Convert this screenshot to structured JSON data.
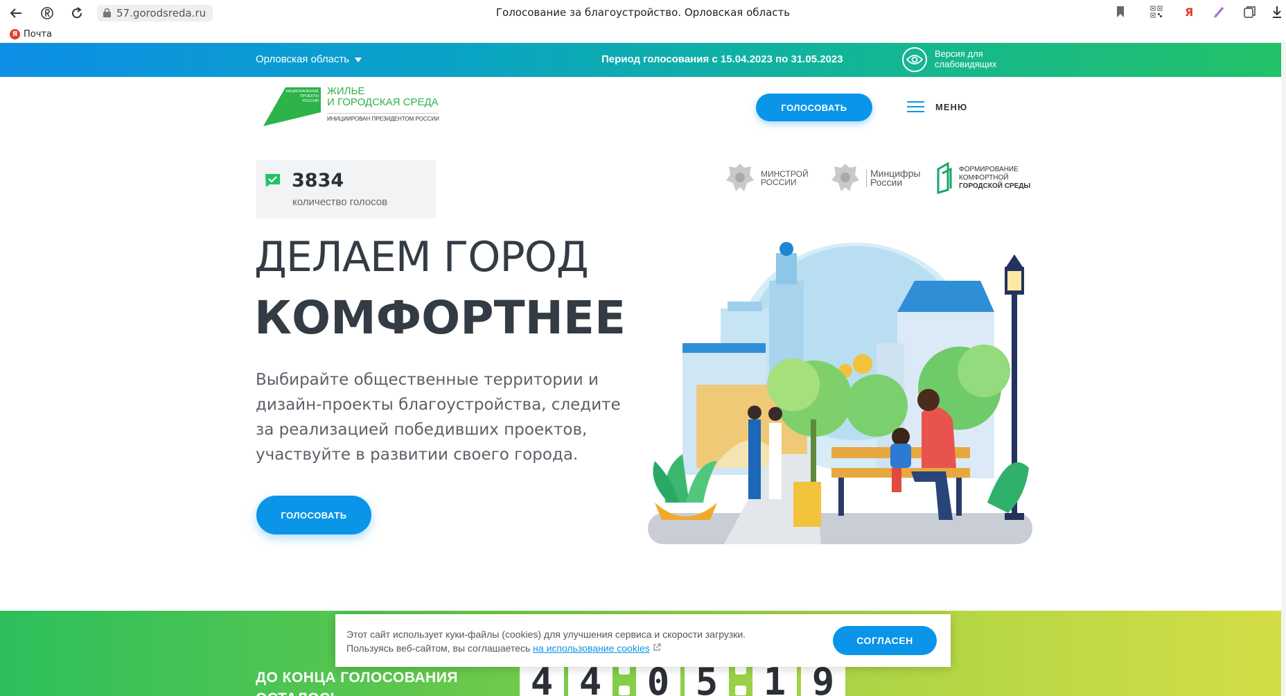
{
  "browser": {
    "url": "57.gorodsreda.ru",
    "tab_title": "Голосование за благоустройство. Орловская область",
    "bookmark_label": "Почта",
    "yandex_letter": "Я"
  },
  "topbar": {
    "region": "Орловская область",
    "period": "Период голосования с 15.04.2023 по 31.05.2023",
    "accessible_line1": "Версия для",
    "accessible_line2": "слабовидящих"
  },
  "header": {
    "logo_badge_1": "НАЦИОНАЛЬНЫЕ",
    "logo_badge_2": "ПРОЕКТЫ",
    "logo_badge_3": "РОССИИ",
    "logo_title_1": "ЖИЛЬЕ",
    "logo_title_2": "И ГОРОДСКАЯ СРЕДА",
    "logo_tagline": "ИНИЦИИРОВАН ПРЕЗИДЕНТОМ РОССИИ",
    "vote_button": "ГОЛОСОВАТЬ",
    "menu_label": "МЕНЮ"
  },
  "counter": {
    "value": "3834",
    "label": "количество голосов"
  },
  "partners": [
    {
      "line1": "МИНСТРОЙ",
      "line2": "РОССИИ"
    },
    {
      "line1": "Минцифры",
      "line2": "России"
    },
    {
      "line1": "ФОРМИРОВАНИЕ",
      "line2": "КОМФОРТНОЙ",
      "line3": "ГОРОДСКОЙ СРЕДЫ"
    }
  ],
  "hero": {
    "title_line1": "ДЕЛАЕМ ГОРОД",
    "title_line2": "КОМФОРТНЕЕ",
    "subtitle": "Выбирайте общественные территории и дизайн-проекты благоустройства, следите за реализацией победивших проектов, участвуйте в развитии своего города.",
    "vote_button": "ГОЛОСОВАТЬ"
  },
  "countdown": {
    "title_line1": "ДО КОНЦА ГОЛОСОВАНИЯ",
    "title_line2": "ОСТАЛОСЬ",
    "digits": [
      "4",
      "4",
      "0",
      "5",
      "1",
      "9"
    ]
  },
  "cookie": {
    "line1": "Этот сайт использует куки-файлы (cookies) для улучшения сервиса и скорости загрузки.",
    "line2_prefix": "Пользуясь веб-сайтом, вы соглашаетесь",
    "link": "на использование cookies",
    "agree_button": "СОГЛАСЕН"
  },
  "colors": {
    "accent_blue": "#0a95e8",
    "brand_green": "#2cb34a",
    "text_dark": "#333b44"
  }
}
